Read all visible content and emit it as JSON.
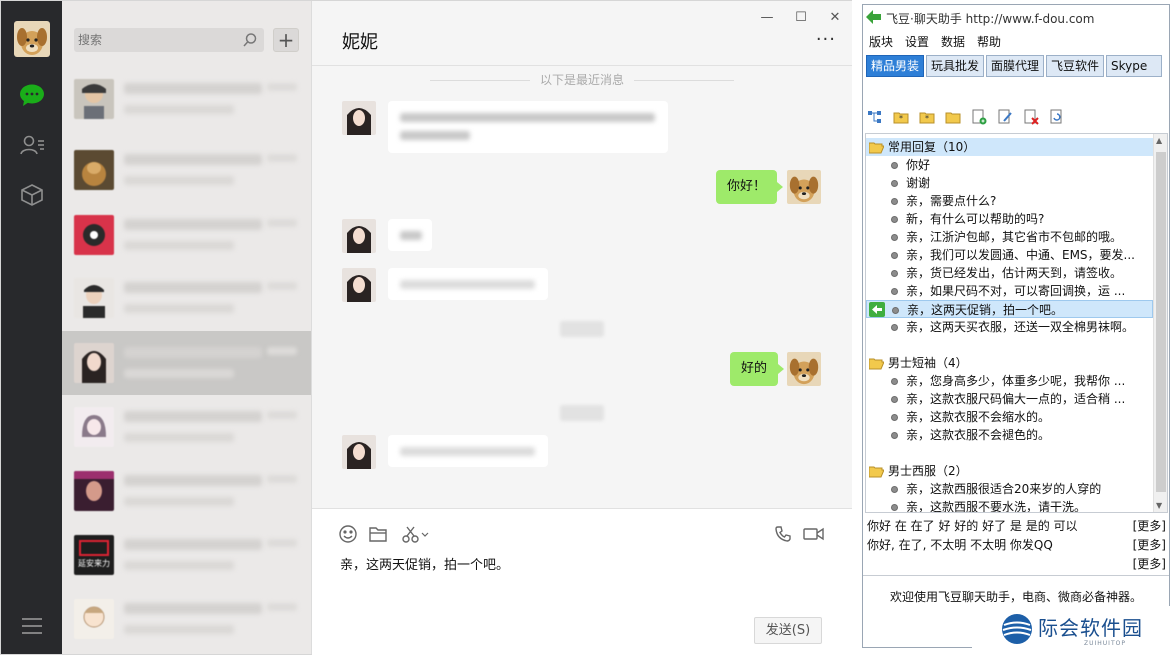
{
  "wechat": {
    "search_placeholder": "搜索",
    "add_label": "+",
    "chat_title": "妮妮",
    "more_label": "···",
    "recent_divider": "以下是最近消息",
    "sent_messages": [
      "你好！",
      "好的"
    ],
    "input_text": "亲，这两天促销，拍一个吧。",
    "send_label": "发送(S)",
    "window_controls": [
      "—",
      "☐",
      "✕"
    ],
    "contact_avatar_text_6": "延安来力",
    "icons": [
      "chat-icon",
      "contacts-icon",
      "favorites-icon",
      "menu-icon",
      "search-icon",
      "emoji-icon",
      "folder-icon",
      "scissors-icon",
      "phone-icon",
      "video-icon"
    ]
  },
  "feidou": {
    "title": "飞豆·聊天助手 http://www.f-dou.com",
    "menus": [
      "版块",
      "设置",
      "数据",
      "帮助"
    ],
    "tabs": [
      "精品男装",
      "玩具批发",
      "面膜代理",
      "飞豆软件",
      "Skype"
    ],
    "active_tab": "精品男装",
    "groups": [
      {
        "label": "常用回复（10）",
        "items": [
          "你好",
          "谢谢",
          "亲，需要点什么?",
          "新，有什么可以帮助的吗?",
          "亲，江浙沪包邮，其它省市不包邮的哦。",
          "亲，我们可以发圆通、中通、EMS，要发...",
          "亲，货已经发出，估计两天到，请签收。",
          "亲，如果尺码不对，可以寄回调换，运 ...",
          "亲，这两天促销，拍一个吧。",
          "亲，这两天买衣服，还送一双全棉男袜啊。"
        ]
      },
      {
        "label": "男士短袖（4）",
        "items": [
          "亲，您身高多少，体重多少呢，我帮你 ...",
          "亲，这款衣服尺码偏大一点的，适合稍 ...",
          "亲，这款衣服不会缩水的。",
          "亲，这款衣服不会褪色的。"
        ]
      },
      {
        "label": "男士西服（2）",
        "items": [
          "亲，这款西服很适合20来岁的人穿的",
          "亲，这款西服不要水洗，请干洗。"
        ]
      }
    ],
    "selected_item": "亲，这两天促销，拍一个吧。",
    "phrases_line1": "你好  在  在了  好  好的  好了  是  是的  可以",
    "phrases_line2": "你好,   在了,    不太明  不太明  你发QQ",
    "more_label": "[更多]",
    "welcome": "欢迎使用飞豆聊天助手，电商、微商必备神器。"
  },
  "watermark": {
    "text": "际会软件园",
    "subtext": "ZUIHUITOP"
  },
  "colors": {
    "nav_bg": "#28292c",
    "bubble_green": "#9eea6a",
    "wechat_green": "#1aad19",
    "tab_active": "#2e7fd7"
  }
}
